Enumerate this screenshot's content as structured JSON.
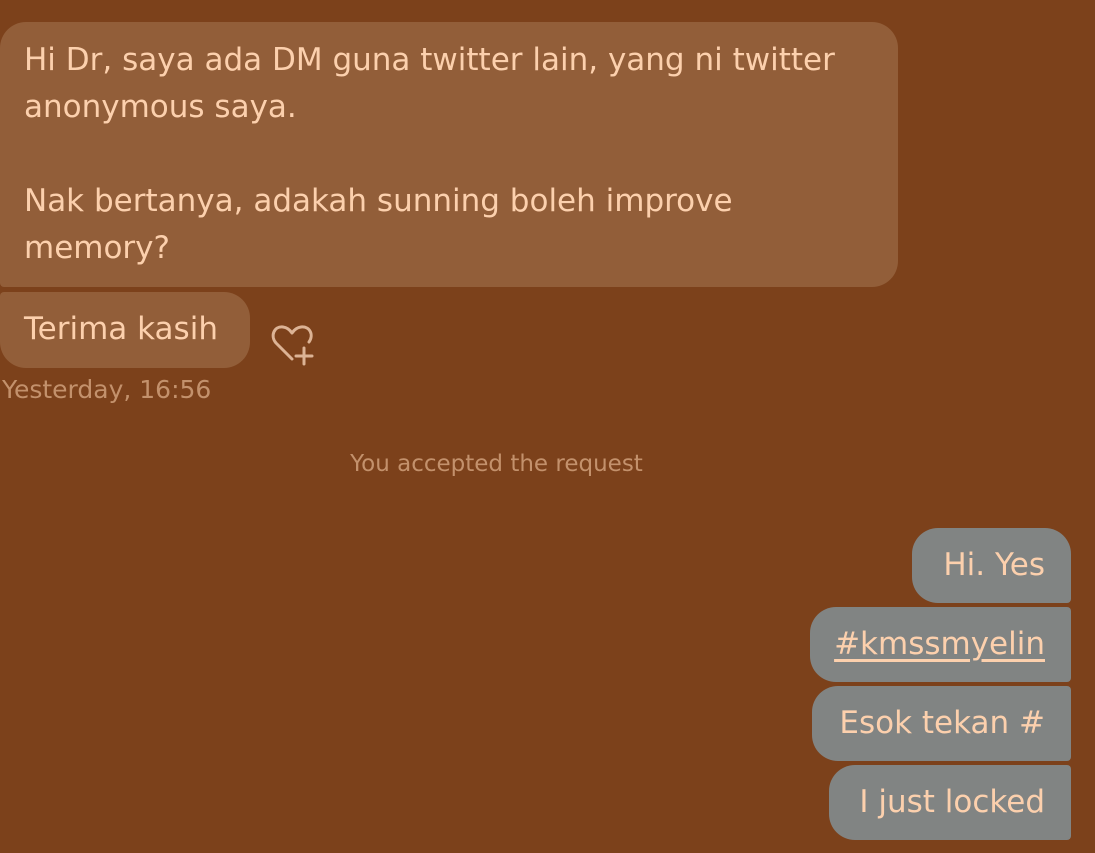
{
  "conversation": {
    "incoming": {
      "message1": {
        "lines": [
          "Hi Dr, saya ada DM guna twitter lain, yang ni twitter",
          "anonymous saya.",
          "Nak bertanya, adakah sunning boleh improve",
          "memory?"
        ]
      },
      "message2": {
        "text": "Terima kasih"
      },
      "timestamp": "Yesterday, 16:56"
    },
    "system_note": "You accepted the request",
    "outgoing": [
      {
        "text": "Hi. Yes"
      },
      {
        "text": "#kmssmyelin"
      },
      {
        "text": "Esok tekan #"
      },
      {
        "text": "I just locked"
      }
    ]
  },
  "icons": {
    "add_reaction": "heart-plus-icon"
  },
  "colors": {
    "background": "#7c411b",
    "incoming_bubble": "#925e39",
    "outgoing_bubble": "#818483",
    "text": "#fcd0ad",
    "muted_text": "#c3916c"
  }
}
